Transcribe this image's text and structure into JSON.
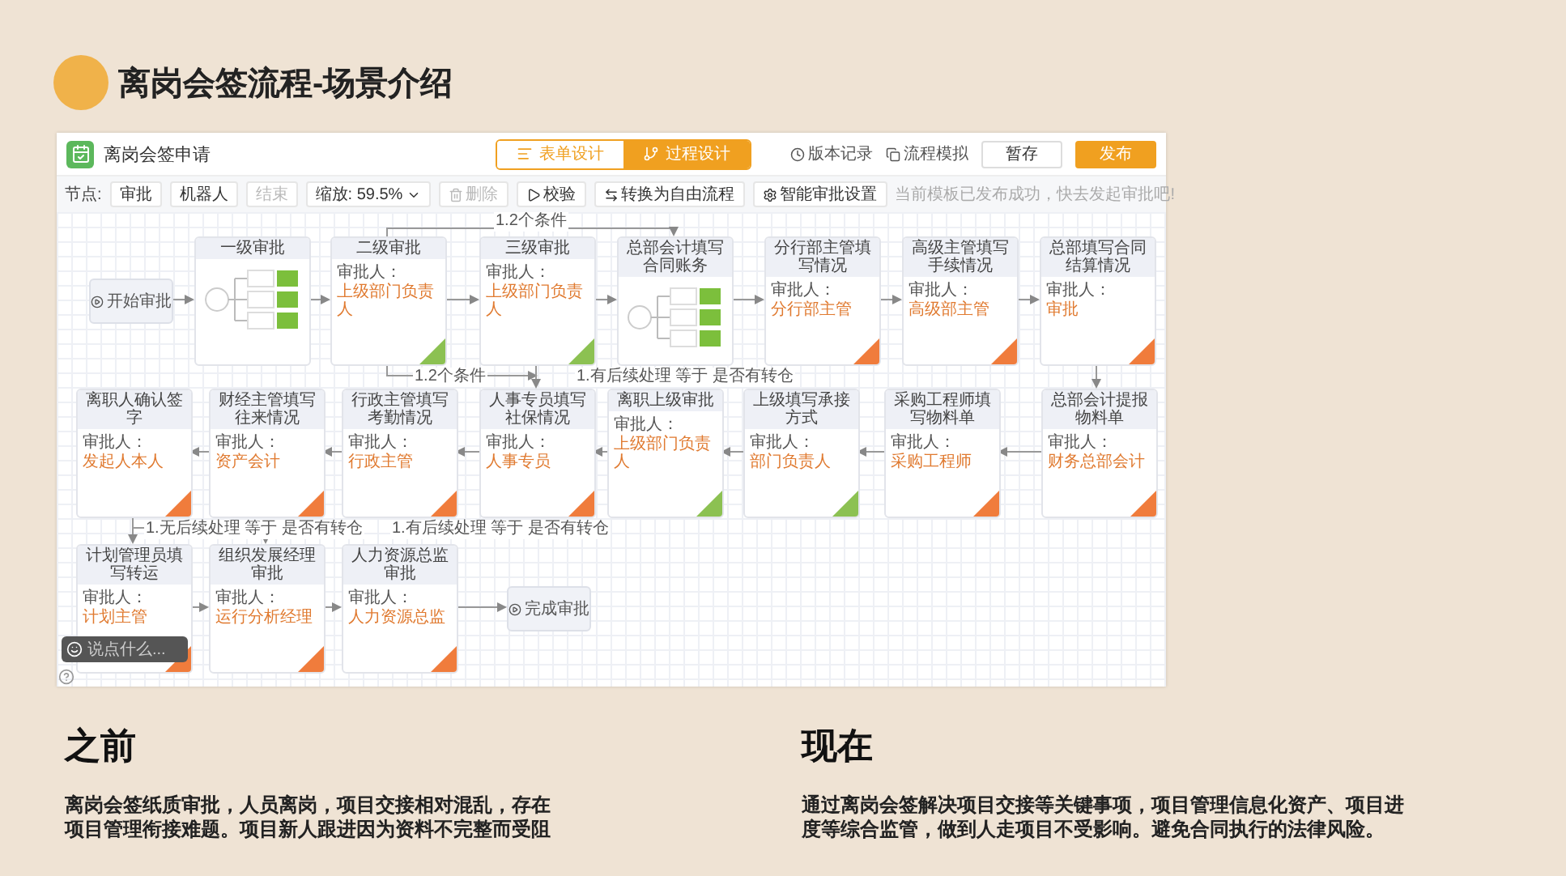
{
  "slide": {
    "title": "离岗会签流程-场景介绍"
  },
  "app": {
    "title": "离岗会签申请",
    "tabs": [
      {
        "label": "表单设计",
        "selected": false
      },
      {
        "label": "过程设计",
        "selected": true
      }
    ],
    "links": [
      "版本记录",
      "流程模拟"
    ],
    "buttons": [
      {
        "label": "暂存",
        "kind": "secondary"
      },
      {
        "label": "发布",
        "kind": "primary"
      }
    ]
  },
  "toolbar": {
    "nodes_label": "节点:",
    "node_buttons": [
      {
        "label": "审批",
        "disabled": false
      },
      {
        "label": "机器人",
        "disabled": false
      },
      {
        "label": "结束",
        "disabled": true
      }
    ],
    "zoom": {
      "label": "缩放:",
      "value": "59.5%"
    },
    "actions": [
      {
        "label": "删除",
        "kind": "delete",
        "disabled": true
      },
      {
        "label": "校验",
        "kind": "validate",
        "disabled": false
      },
      {
        "label": "转换为自由流程",
        "kind": "convert",
        "disabled": false
      },
      {
        "label": "智能审批设置",
        "kind": "smart",
        "disabled": false
      }
    ],
    "notice": "当前模板已发布成功，快去发起审批吧!"
  },
  "flow_nodes": [
    {
      "kind": "start",
      "title": "开始审批"
    },
    {
      "kind": "condition",
      "title": "一级审批"
    },
    {
      "kind": "approval",
      "title": "二级审批",
      "approver_label": "审批人：",
      "approver": "上级部门负责人",
      "color": "#8cc152"
    },
    {
      "kind": "approval",
      "title": "三级审批",
      "approver_label": "审批人：",
      "approver": "上级部门负责人",
      "color": "#8cc152"
    },
    {
      "kind": "condition",
      "title": "总部会计填写合同账务"
    },
    {
      "kind": "approval",
      "title": "分行部主管填写情况",
      "approver_label": "审批人：",
      "approver": "分行部主管",
      "color": "#f07c3c"
    },
    {
      "kind": "approval",
      "title": "高级主管填写手续情况",
      "approver_label": "审批人：",
      "approver": "高级部主管",
      "color": "#f07c3c"
    },
    {
      "kind": "approval",
      "title": "总部填写合同结算情况",
      "approver_label": "审批人：",
      "approver": "审批",
      "color": "#f07c3c"
    },
    {
      "kind": "approval",
      "title": "离职人确认签字",
      "approver_label": "审批人：",
      "approver": "发起人本人",
      "color": "#f07c3c"
    },
    {
      "kind": "approval",
      "title": "财经主管填写往来情况",
      "approver_label": "审批人：",
      "approver": "资产会计",
      "color": "#f07c3c"
    },
    {
      "kind": "approval",
      "title": "行政主管填写考勤情况",
      "approver_label": "审批人：",
      "approver": "行政主管",
      "color": "#f07c3c"
    },
    {
      "kind": "approval",
      "title": "人事专员填写社保情况",
      "approver_label": "审批人：",
      "approver": "人事专员",
      "color": "#f07c3c"
    },
    {
      "kind": "approval",
      "title": "离职上级审批",
      "approver_label": "审批人：",
      "approver": "上级部门负责人",
      "color": "#8cc152"
    },
    {
      "kind": "approval",
      "title": "上级填写承接方式",
      "approver_label": "审批人：",
      "approver": "部门负责人",
      "color": "#8cc152"
    },
    {
      "kind": "approval",
      "title": "采购工程师填写物料单",
      "approver_label": "审批人：",
      "approver": "采购工程师",
      "color": "#f07c3c"
    },
    {
      "kind": "approval",
      "title": "总部会计提报物料单",
      "approver_label": "审批人：",
      "approver": "财务总部会计",
      "color": "#f07c3c"
    },
    {
      "kind": "approval",
      "title": "计划管理员填写转运",
      "approver_label": "审批人：",
      "approver": "计划主管",
      "color": "#f07c3c"
    },
    {
      "kind": "approval",
      "title": "组织发展经理审批",
      "approver_label": "审批人：",
      "approver": "运行分析经理",
      "color": "#f07c3c"
    },
    {
      "kind": "approval",
      "title": "人力资源总监审批",
      "approver_label": "审批人：",
      "approver": "人力资源总监",
      "color": "#f07c3c"
    },
    {
      "kind": "end",
      "title": "完成审批"
    }
  ],
  "flow_labels": [
    "1.2个条件",
    "1.2个条件",
    "1.有后续处理 等于 是否有转仓",
    "1.无后续处理 等于 是否有转仓",
    "1.有后续处理 等于 是否有转仓"
  ],
  "chat": {
    "placeholder": "说点什么..."
  },
  "before": {
    "heading": "之前",
    "text": "离岗会签纸质审批，人员离岗，项目交接相对混乱，存在项目管理衔接难题。项目新人跟进因为资料不完整而受阻"
  },
  "after": {
    "heading": "现在",
    "text": "通过离岗会签解决项目交接等关键事项，项目管理信息化资产、项目进度等综合监管，做到人走项目不受影响。避免合同执行的法律风险。"
  }
}
